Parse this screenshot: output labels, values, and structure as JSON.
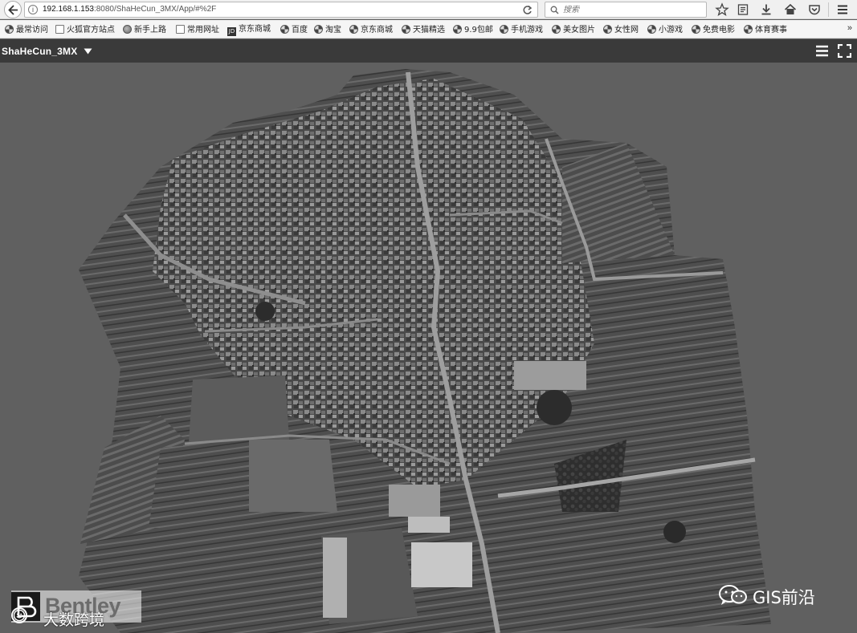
{
  "browser": {
    "url_host": "192.168.1.153",
    "url_rest": ":8080/ShaHeCun_3MX/App/#%2F",
    "search_placeholder": "搜索"
  },
  "bookmarks": [
    {
      "label": "最常访问",
      "icon": "gear-icon"
    },
    {
      "label": "火狐官方站点",
      "icon": "doc-icon"
    },
    {
      "label": "新手上路",
      "icon": "globe-icon"
    },
    {
      "label": "常用网址",
      "icon": "doc-icon"
    },
    {
      "label": "京东商城",
      "icon": "jd-icon"
    },
    {
      "label": "百度",
      "icon": "spin-icon"
    },
    {
      "label": "淘宝",
      "icon": "spin-icon"
    },
    {
      "label": "京东商城",
      "icon": "spin-icon"
    },
    {
      "label": "天猫精选",
      "icon": "spin-icon"
    },
    {
      "label": "9.9包邮",
      "icon": "spin-icon"
    },
    {
      "label": "手机游戏",
      "icon": "spin-icon"
    },
    {
      "label": "美女图片",
      "icon": "spin-icon"
    },
    {
      "label": "女性网",
      "icon": "spin-icon"
    },
    {
      "label": "小游戏",
      "icon": "spin-icon"
    },
    {
      "label": "免费电影",
      "icon": "spin-icon"
    },
    {
      "label": "体育赛事",
      "icon": "spin-icon"
    }
  ],
  "bookmarks_overflow": "»",
  "app": {
    "title": "ShaHeCun_3MX"
  },
  "overlays": {
    "bentley_logo_text": "Bentley",
    "watermark_cn": "大数跨境",
    "watermark_gis": "GIS前沿"
  }
}
